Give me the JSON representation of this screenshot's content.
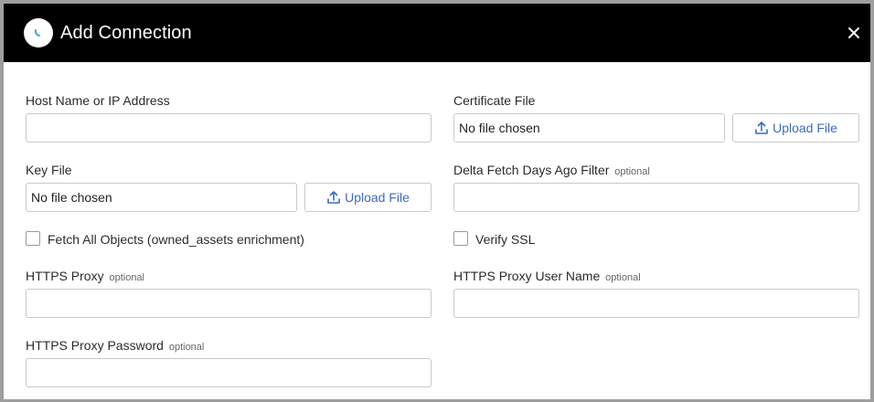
{
  "dialog": {
    "title": "Add Connection",
    "logo_icon": "app-logo-icon",
    "close_icon": "close-icon"
  },
  "fields": {
    "host": {
      "label": "Host Name or IP Address",
      "value": ""
    },
    "certificate_file": {
      "label": "Certificate File",
      "file_text": "No file chosen",
      "upload_label": "Upload File",
      "upload_icon": "upload-icon"
    },
    "key_file": {
      "label": "Key File",
      "file_text": "No file chosen",
      "upload_label": "Upload File",
      "upload_icon": "upload-icon"
    },
    "delta_fetch": {
      "label": "Delta Fetch Days Ago Filter",
      "optional": "optional",
      "value": ""
    },
    "fetch_all_objects": {
      "label": "Fetch All Objects (owned_assets enrichment)",
      "checked": false
    },
    "verify_ssl": {
      "label": "Verify SSL",
      "checked": false
    },
    "https_proxy": {
      "label": "HTTPS Proxy",
      "optional": "optional",
      "value": ""
    },
    "https_proxy_user": {
      "label": "HTTPS Proxy User Name",
      "optional": "optional",
      "value": ""
    },
    "https_proxy_password": {
      "label": "HTTPS Proxy Password",
      "optional": "optional",
      "value": ""
    }
  },
  "colors": {
    "header_bg": "#000000",
    "link_blue": "#3d6cb9",
    "border": "#c9c9c9"
  }
}
